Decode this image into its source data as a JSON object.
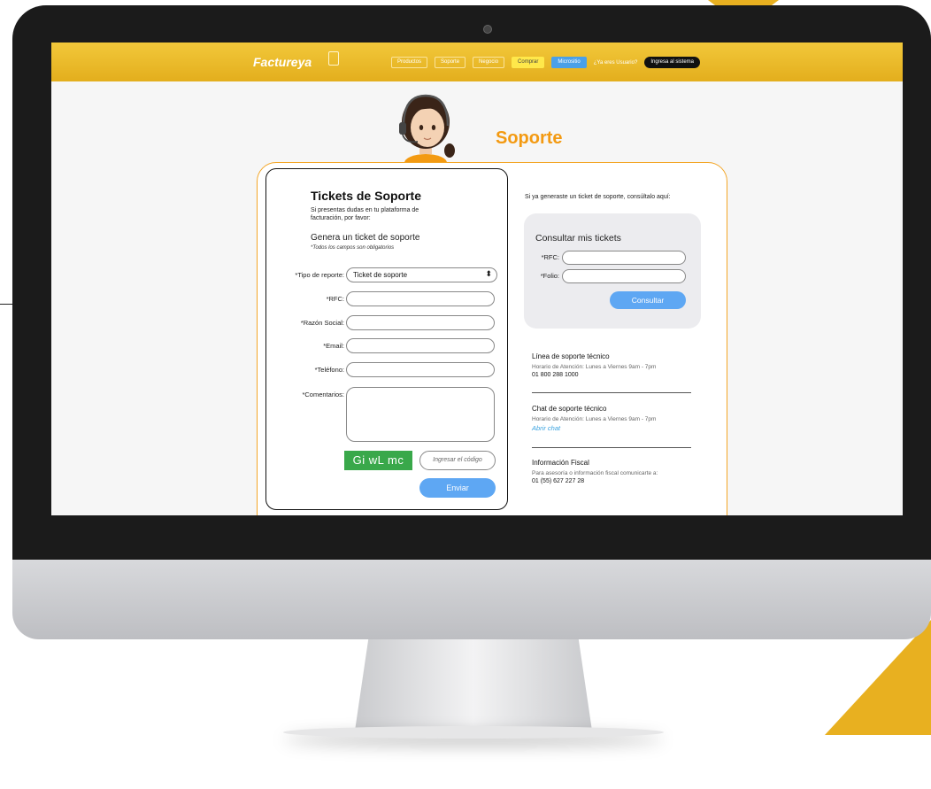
{
  "header": {
    "logo": "Factureya",
    "nav": [
      "Productos",
      "Soporte",
      "Negocio",
      "Comprar",
      "Micrositio"
    ],
    "question": "¿Ya eres Usuario?",
    "login_label": "Ingresa al sistema"
  },
  "page": {
    "title": "Soporte"
  },
  "ticket_form": {
    "title": "Tickets de Soporte",
    "subtitle": "Si presentas dudas en tu plataforma de facturación, por favor:",
    "generate": "Genera un ticket de soporte",
    "required_note": "*Todos los campos son obligatorios",
    "fields": {
      "report_type_label": "*Tipo de reporte:",
      "report_type_value": "Ticket de soporte",
      "rfc_label": "*RFC:",
      "razon_label": "*Razón Social:",
      "email_label": "*Email:",
      "phone_label": "*Teléfono:",
      "comments_label": "*Comentarios:"
    },
    "captcha_text": "Gi wL mc",
    "captcha_placeholder": "Ingresar el código",
    "submit_label": "Enviar"
  },
  "consult": {
    "prompt": "Si ya generaste un ticket de soporte, consúltalo aquí:",
    "title": "Consultar mis tickets",
    "rfc_label": "*RFC:",
    "folio_label": "*Folio:",
    "button_label": "Consultar"
  },
  "support_info": [
    {
      "title": "Línea de soporte técnico",
      "text": "Horario de Atención: Lunes a Viernes 9am - 7pm",
      "value": "01 800 288 1000"
    },
    {
      "title": "Chat de soporte técnico",
      "text": "Horario de Atención: Lunes a Viernes 9am - 7pm",
      "link": "Abrir chat"
    },
    {
      "title": "Información Fiscal",
      "text": "Para asesoría o información fiscal comunicarte a:",
      "value": "01 (55) 627 227 28"
    }
  ],
  "colors": {
    "brand_yellow": "#e8b020",
    "title_orange": "#f39a12",
    "button_blue": "#5ea7f3",
    "captcha_green": "#39a84a"
  }
}
